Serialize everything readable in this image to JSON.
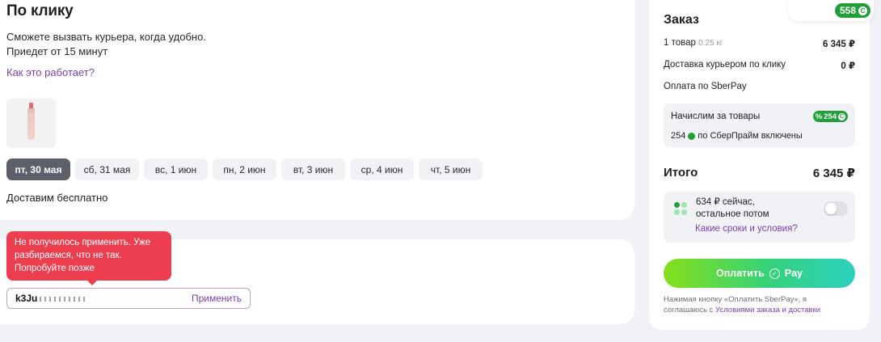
{
  "delivery": {
    "title": "По клику",
    "desc_line1": "Сможете вызвать курьера, когда удобно.",
    "desc_line2": "Приедет от 15 минут",
    "how_link": "Как это работает?",
    "dates": [
      {
        "label": "пт, 30 мая",
        "active": true
      },
      {
        "label": "сб, 31 мая",
        "active": false
      },
      {
        "label": "вс, 1 июн",
        "active": false
      },
      {
        "label": "пн, 2 июн",
        "active": false
      },
      {
        "label": "вт, 3 июн",
        "active": false
      },
      {
        "label": "ср, 4 июн",
        "active": false
      },
      {
        "label": "чт, 5 июн",
        "active": false
      }
    ],
    "free_text": "Доставим бесплатно"
  },
  "promo": {
    "error_line1": "Не получилось применить. Уже",
    "error_line2": "разбираемся, что не так.",
    "error_line3": "Попробуйте позже",
    "code_value": "k3Ju",
    "apply_label": "Применить"
  },
  "order": {
    "bonus_total": "558",
    "title": "Заказ",
    "items_label": "1 товар",
    "items_weight": "0.25 кг",
    "items_price": "6 345 ₽",
    "delivery_label": "Доставка курьером по клику",
    "delivery_price": "0 ₽",
    "payment_label": "Оплата по SberPay",
    "cashback_label": "Начислим за товары",
    "cashback_badge": "254",
    "cashback_prime_amount": "254",
    "cashback_prime_text": "по СберПрайм включены",
    "total_label": "Итого",
    "total_value": "6 345 ₽",
    "split_line1": "634 ₽ сейчас,",
    "split_line2": "остальное потом",
    "split_link": "Какие сроки и условия?",
    "pay_label": "Оплатить",
    "pay_suffix": "Pay",
    "terms_line1": "Нажимая кнопку «Оплатить SberPay», я",
    "terms_prefix": "соглашаюсь с ",
    "terms_link": "Условиями заказа и доставки"
  },
  "colors": {
    "accent_purple": "#7b3fb0",
    "sber_green": "#21a038",
    "error_red": "#ec3e4f",
    "active_date": "#5c6069"
  }
}
